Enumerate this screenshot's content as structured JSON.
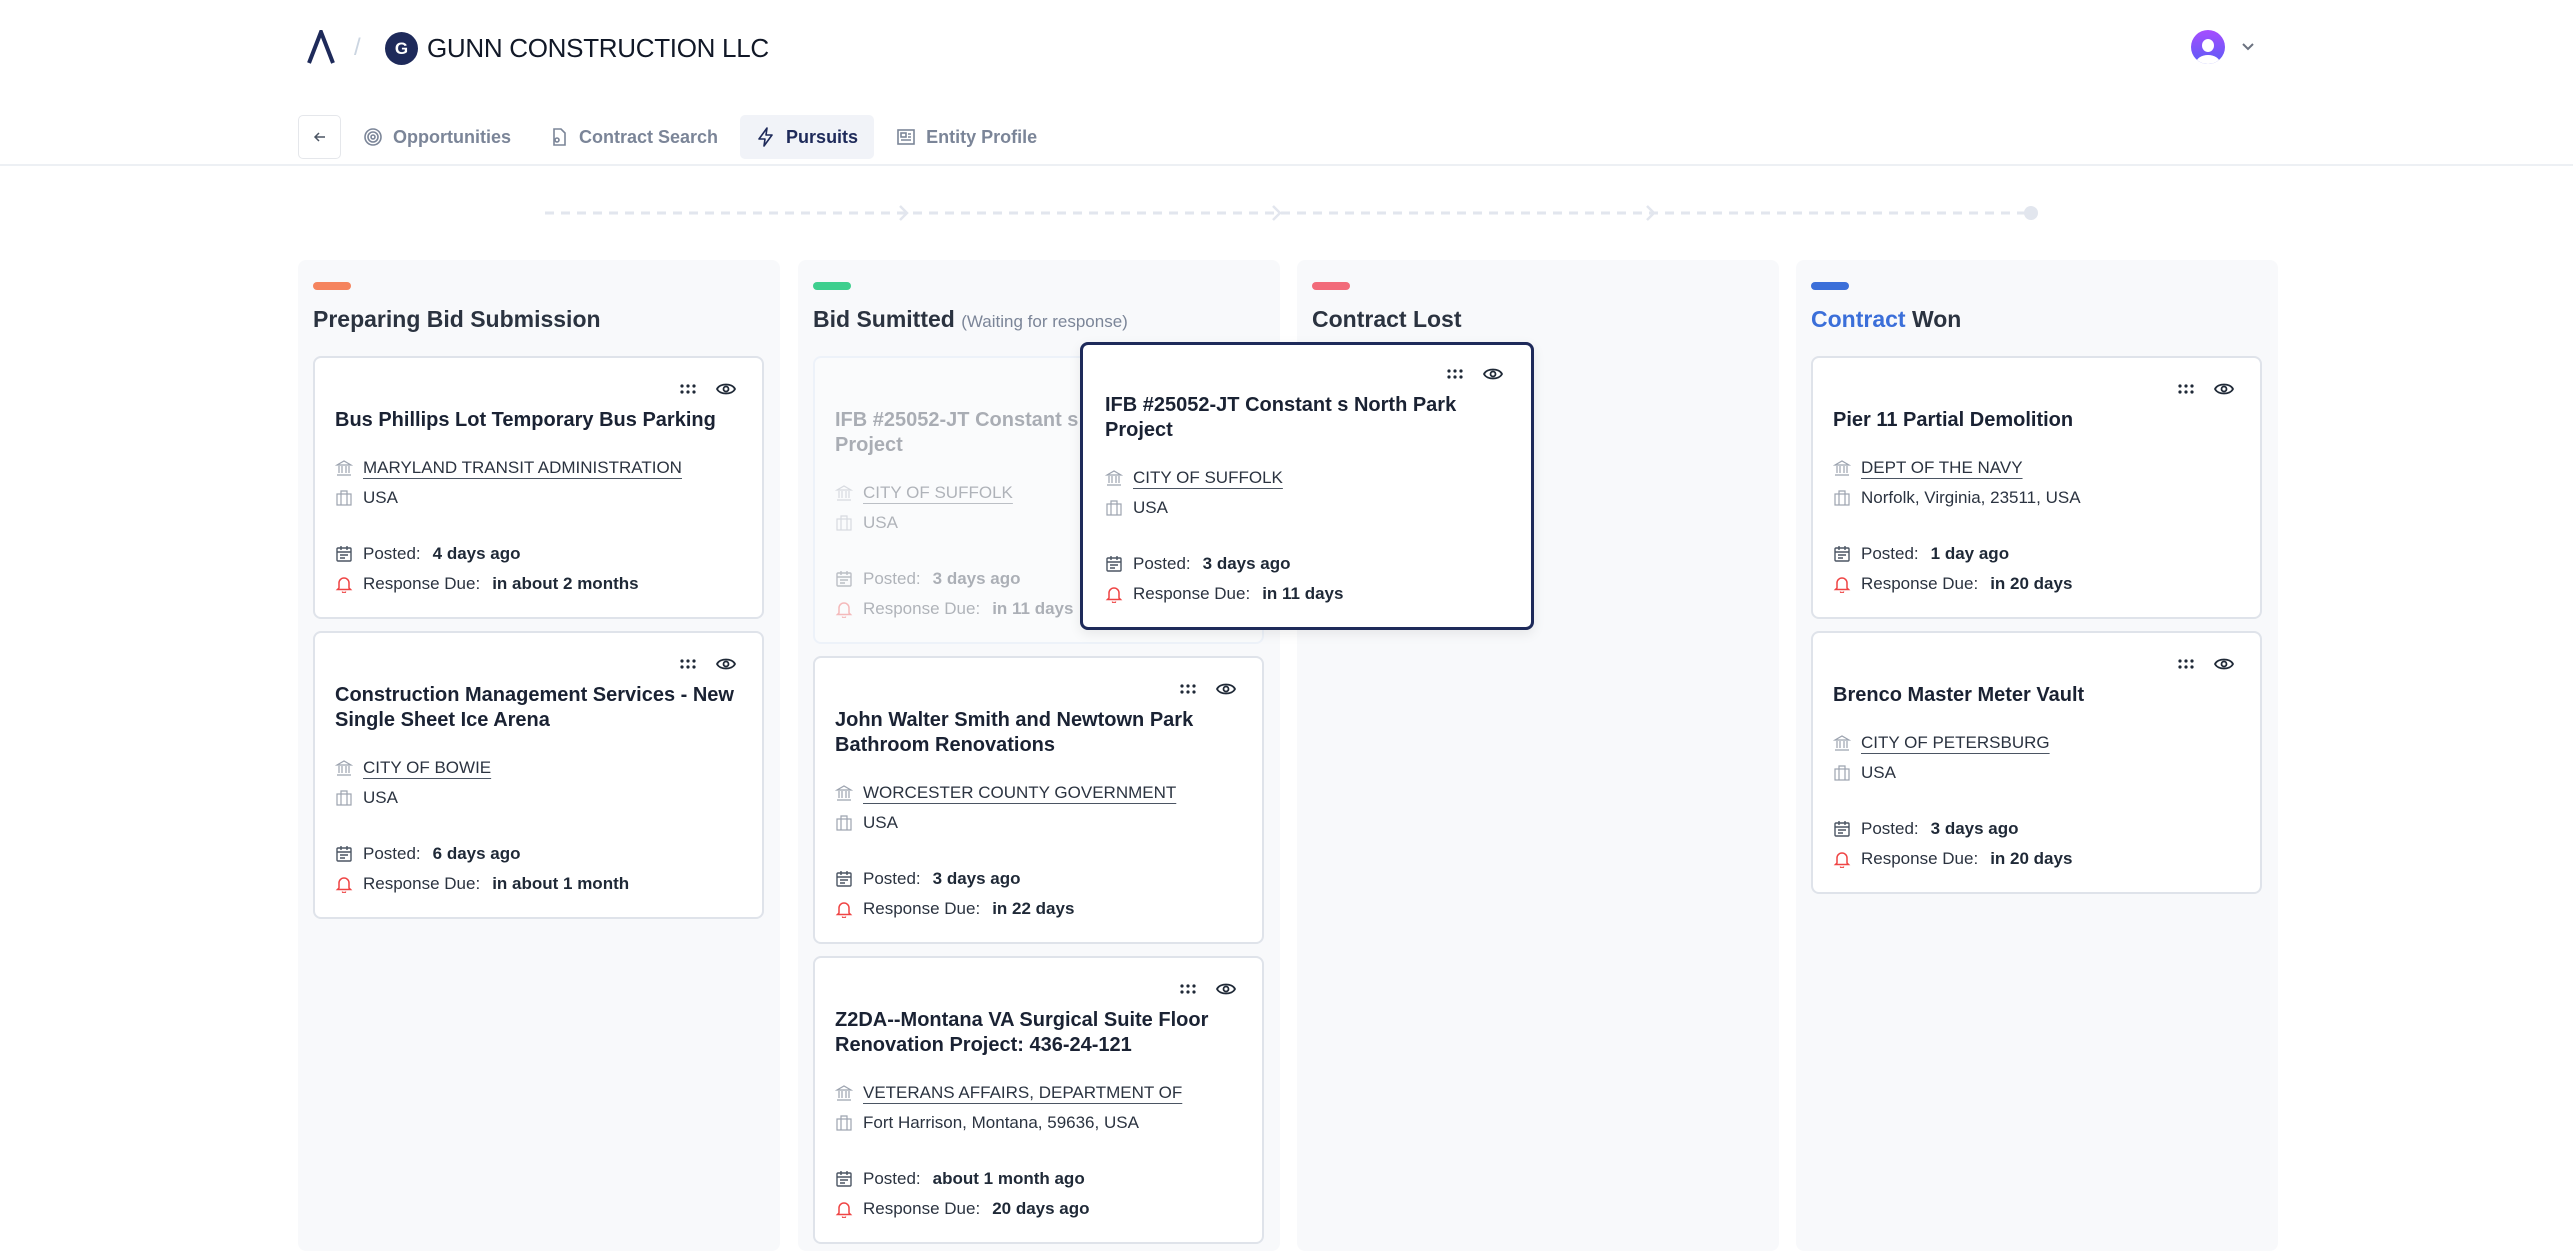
{
  "header": {
    "org_initial": "G",
    "org_name": "GUNN CONSTRUCTION LLC"
  },
  "tabs": [
    {
      "label": "Opportunities",
      "icon": "target-icon",
      "active": false
    },
    {
      "label": "Contract Search",
      "icon": "file-search-icon",
      "active": false
    },
    {
      "label": "Pursuits",
      "icon": "lightning-icon",
      "active": true
    },
    {
      "label": "Entity Profile",
      "icon": "newspaper-icon",
      "active": false
    }
  ],
  "labels": {
    "posted": "Posted:",
    "due": "Response Due:"
  },
  "colors": {
    "accent": "#1e2a5a",
    "due_icon": "#ef4444"
  },
  "columns": [
    {
      "title": "Preparing Bid Submission",
      "title_accent": "",
      "subtitle": "",
      "color": "#f5845e",
      "cards": [
        {
          "title": "Bus Phillips Lot Temporary Bus Parking",
          "agency": "MARYLAND TRANSIT ADMINISTRATION",
          "location": "USA",
          "posted": "4 days ago",
          "due": "in about 2 months"
        },
        {
          "title": "Construction Management Services - New Single Sheet Ice Arena",
          "agency": "CITY OF BOWIE",
          "location": "USA",
          "posted": "6 days ago",
          "due": "in about 1 month"
        }
      ]
    },
    {
      "title": "Bid Sumitted",
      "title_accent": "",
      "subtitle": "(Waiting for response)",
      "color": "#3ecf8e",
      "cards": [
        {
          "title": "IFB #25052-JT Constant s North Park Project",
          "agency": "CITY OF SUFFOLK",
          "location": "USA",
          "posted": "3 days ago",
          "due": "in 11 days",
          "ghost": true
        },
        {
          "title": "John Walter Smith and Newtown Park Bathroom Renovations",
          "agency": "WORCESTER COUNTY GOVERNMENT",
          "location": "USA",
          "posted": "3 days ago",
          "due": "in 22 days"
        },
        {
          "title": "Z2DA--Montana VA Surgical Suite Floor Renovation Project: 436-24-121",
          "agency": "VETERANS AFFAIRS, DEPARTMENT OF",
          "location": "Fort Harrison, Montana, 59636, USA",
          "posted": "about 1 month ago",
          "due": "20 days ago"
        }
      ]
    },
    {
      "title": "Contract Lost",
      "title_accent": "",
      "subtitle": "",
      "color": "#f26b7a",
      "cards": []
    },
    {
      "title": "Won",
      "title_accent": "Contract",
      "subtitle": "",
      "color": "#3b6fd9",
      "cards": [
        {
          "title": "Pier 11 Partial Demolition",
          "agency": "DEPT OF THE NAVY",
          "location": "Norfolk, Virginia, 23511, USA",
          "posted": "1 day ago",
          "due": "in 20 days"
        },
        {
          "title": "Brenco Master Meter Vault",
          "agency": "CITY OF PETERSBURG",
          "location": "USA",
          "posted": "3 days ago",
          "due": "in 20 days"
        }
      ]
    }
  ],
  "dragging_card": {
    "title": "IFB #25052-JT Constant s North Park Project",
    "agency": "CITY OF SUFFOLK",
    "location": "USA",
    "posted": "3 days ago",
    "due": "in 11 days"
  }
}
